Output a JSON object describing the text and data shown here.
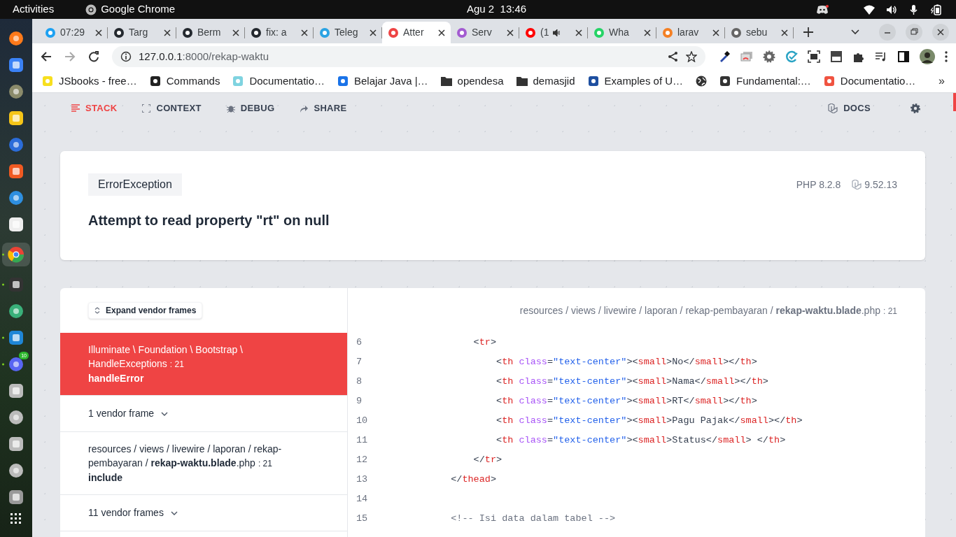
{
  "topbar": {
    "activities": "Activities",
    "app_name": "Google Chrome",
    "clock": "Agu 2  13:46"
  },
  "dock": {
    "items": [
      {
        "running": false
      },
      {
        "running": false
      },
      {
        "running": false
      },
      {
        "running": false
      },
      {
        "running": false
      },
      {
        "running": false
      },
      {
        "running": false
      },
      {
        "running": false
      },
      {
        "running": true
      },
      {
        "running": true
      },
      {
        "running": false
      },
      {
        "running": true
      },
      {
        "running": true
      },
      {
        "running": false
      },
      {
        "running": false
      },
      {
        "running": false
      },
      {
        "running": false
      },
      {
        "running": false
      }
    ],
    "discord_badge": "10"
  },
  "tabs": [
    {
      "title": "07:29",
      "selected": false,
      "audio": false
    },
    {
      "title": "Targ",
      "selected": false,
      "audio": false
    },
    {
      "title": "Berm",
      "selected": false,
      "audio": false
    },
    {
      "title": "fix: a",
      "selected": false,
      "audio": false
    },
    {
      "title": "Teleg",
      "selected": false,
      "audio": false
    },
    {
      "title": "Atter",
      "selected": true,
      "audio": false
    },
    {
      "title": "Serv",
      "selected": false,
      "audio": false
    },
    {
      "title": "(1",
      "selected": false,
      "audio": true
    },
    {
      "title": "Wha",
      "selected": false,
      "audio": false
    },
    {
      "title": "larav",
      "selected": false,
      "audio": false
    },
    {
      "title": "sebu",
      "selected": false,
      "audio": false
    }
  ],
  "address": {
    "host": "127.0.0.1",
    "path": ":8000/rekap-waktu"
  },
  "bookmarks": [
    {
      "label": "JSbooks - free…",
      "kind": "site"
    },
    {
      "label": "Commands",
      "kind": "site"
    },
    {
      "label": "Documentatio…",
      "kind": "site"
    },
    {
      "label": "Belajar Java |…",
      "kind": "site"
    },
    {
      "label": "opendesa",
      "kind": "folder"
    },
    {
      "label": "demasjid",
      "kind": "folder"
    },
    {
      "label": "Examples of U…",
      "kind": "site"
    },
    {
      "kind": "globe"
    },
    {
      "label": "Fundamental:…",
      "kind": "site"
    },
    {
      "label": "Documentatio…",
      "kind": "site"
    }
  ],
  "bookmarks_more": "»",
  "nav": {
    "items": [
      {
        "label": "STACK",
        "selected": true
      },
      {
        "label": "CONTEXT",
        "selected": false
      },
      {
        "label": "DEBUG",
        "selected": false
      },
      {
        "label": "SHARE",
        "selected": false
      }
    ],
    "docs": "DOCS"
  },
  "error": {
    "type": "ErrorException",
    "message": "Attempt to read property \"rt\" on null",
    "php": "PHP 8.2.8",
    "laravel": "9.52.13"
  },
  "stack": {
    "expand_button": "Expand vendor frames",
    "frames": [
      {
        "kind": "frame",
        "selected": true,
        "path": "Illuminate \\ Foundation \\ Bootstrap \\ HandleExceptions",
        "line": ": 21",
        "method": "handleError"
      },
      {
        "kind": "vendor_group",
        "label": "1 vendor frame"
      },
      {
        "kind": "frame",
        "selected": false,
        "path": "resources / views / livewire / laporan / rekap-pembayaran / **rekap-waktu.blade**.php",
        "line": ": 21",
        "method": "include"
      },
      {
        "kind": "vendor_group",
        "label": "11 vendor frames"
      }
    ]
  },
  "code": {
    "file": "resources / views / livewire / laporan / rekap-pembayaran / **rekap-waktu.blade**.php",
    "line": ": 21",
    "lines": [
      {
        "number": "6",
        "tokens": [
          {
            "kind": "punct",
            "text": "                <"
          },
          {
            "kind": "tag",
            "text": "tr"
          },
          {
            "kind": "punct",
            "text": ">"
          }
        ]
      },
      {
        "number": "7",
        "tokens": [
          {
            "kind": "punct",
            "text": "                    <"
          },
          {
            "kind": "tag",
            "text": "th"
          },
          {
            "kind": "attr",
            "text": " class"
          },
          {
            "kind": "punct",
            "text": "="
          },
          {
            "kind": "string",
            "text": "\"text-center\""
          },
          {
            "kind": "punct",
            "text": "><"
          },
          {
            "kind": "tag",
            "text": "small"
          },
          {
            "kind": "punct",
            "text": ">No</"
          },
          {
            "kind": "tag",
            "text": "small"
          },
          {
            "kind": "punct",
            "text": "></"
          },
          {
            "kind": "tag",
            "text": "th"
          },
          {
            "kind": "punct",
            "text": ">"
          }
        ]
      },
      {
        "number": "8",
        "tokens": [
          {
            "kind": "punct",
            "text": "                    <"
          },
          {
            "kind": "tag",
            "text": "th"
          },
          {
            "kind": "attr",
            "text": " class"
          },
          {
            "kind": "punct",
            "text": "="
          },
          {
            "kind": "string",
            "text": "\"text-center\""
          },
          {
            "kind": "punct",
            "text": "><"
          },
          {
            "kind": "tag",
            "text": "small"
          },
          {
            "kind": "punct",
            "text": ">Nama</"
          },
          {
            "kind": "tag",
            "text": "small"
          },
          {
            "kind": "punct",
            "text": "></"
          },
          {
            "kind": "tag",
            "text": "th"
          },
          {
            "kind": "punct",
            "text": ">"
          }
        ]
      },
      {
        "number": "9",
        "tokens": [
          {
            "kind": "punct",
            "text": "                    <"
          },
          {
            "kind": "tag",
            "text": "th"
          },
          {
            "kind": "attr",
            "text": " class"
          },
          {
            "kind": "punct",
            "text": "="
          },
          {
            "kind": "string",
            "text": "\"text-center\""
          },
          {
            "kind": "punct",
            "text": "><"
          },
          {
            "kind": "tag",
            "text": "small"
          },
          {
            "kind": "punct",
            "text": ">RT</"
          },
          {
            "kind": "tag",
            "text": "small"
          },
          {
            "kind": "punct",
            "text": "></"
          },
          {
            "kind": "tag",
            "text": "th"
          },
          {
            "kind": "punct",
            "text": ">"
          }
        ]
      },
      {
        "number": "10",
        "tokens": [
          {
            "kind": "punct",
            "text": "                    <"
          },
          {
            "kind": "tag",
            "text": "th"
          },
          {
            "kind": "attr",
            "text": " class"
          },
          {
            "kind": "punct",
            "text": "="
          },
          {
            "kind": "string",
            "text": "\"text-center\""
          },
          {
            "kind": "punct",
            "text": "><"
          },
          {
            "kind": "tag",
            "text": "small"
          },
          {
            "kind": "punct",
            "text": ">Pagu Pajak</"
          },
          {
            "kind": "tag",
            "text": "small"
          },
          {
            "kind": "punct",
            "text": "></"
          },
          {
            "kind": "tag",
            "text": "th"
          },
          {
            "kind": "punct",
            "text": ">"
          }
        ]
      },
      {
        "number": "11",
        "tokens": [
          {
            "kind": "punct",
            "text": "                    <"
          },
          {
            "kind": "tag",
            "text": "th"
          },
          {
            "kind": "attr",
            "text": " class"
          },
          {
            "kind": "punct",
            "text": "="
          },
          {
            "kind": "string",
            "text": "\"text-center\""
          },
          {
            "kind": "punct",
            "text": "><"
          },
          {
            "kind": "tag",
            "text": "small"
          },
          {
            "kind": "punct",
            "text": ">Status</"
          },
          {
            "kind": "tag",
            "text": "small"
          },
          {
            "kind": "punct",
            "text": "> </"
          },
          {
            "kind": "tag",
            "text": "th"
          },
          {
            "kind": "punct",
            "text": ">"
          }
        ]
      },
      {
        "number": "12",
        "tokens": [
          {
            "kind": "punct",
            "text": "                </"
          },
          {
            "kind": "tag",
            "text": "tr"
          },
          {
            "kind": "punct",
            "text": ">"
          }
        ]
      },
      {
        "number": "13",
        "tokens": [
          {
            "kind": "punct",
            "text": "            </"
          },
          {
            "kind": "tag",
            "text": "thead"
          },
          {
            "kind": "punct",
            "text": ">"
          }
        ]
      },
      {
        "number": "14"
      },
      {
        "number": "15",
        "tokens": [
          {
            "kind": "comment",
            "text": "            <!-- Isi data dalam tabel -->"
          }
        ]
      }
    ]
  }
}
